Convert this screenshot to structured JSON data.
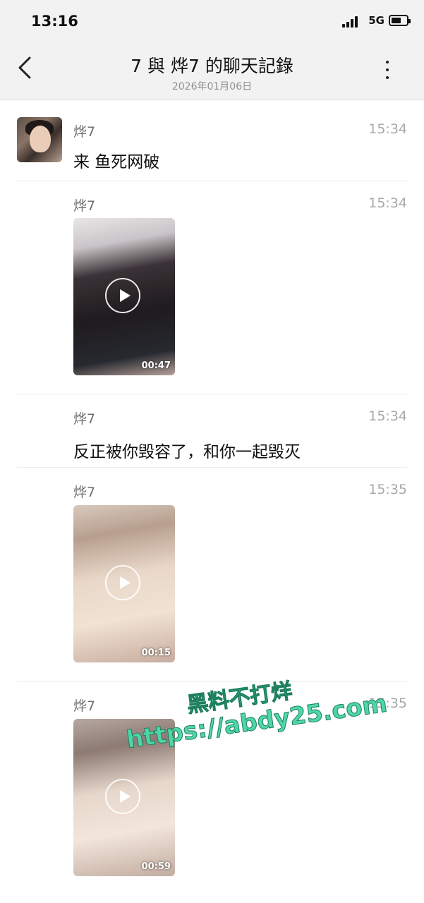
{
  "status": {
    "time": "13:16",
    "network": "5G",
    "icons": [
      "signal-icon",
      "battery-icon"
    ]
  },
  "header": {
    "title": "7 與 烨7 的聊天記錄",
    "date": "2026年01月06日",
    "back_icon": "chevron-left-icon",
    "more_icon": "more-vertical-icon"
  },
  "messages": [
    {
      "type": "text",
      "sender": "烨7",
      "time": "15:34",
      "content": "来 鱼死网破"
    },
    {
      "type": "video",
      "sender": "烨7",
      "time": "15:34",
      "duration": "00:47"
    },
    {
      "type": "text",
      "sender": "烨7",
      "time": "15:34",
      "content": "反正被你毁容了，和你一起毁灭"
    },
    {
      "type": "video",
      "sender": "烨7",
      "time": "15:35",
      "duration": "00:15"
    },
    {
      "type": "video",
      "sender": "烨7",
      "time": "15:35",
      "duration": "00:59"
    }
  ],
  "watermark": {
    "line1": "黑料不打烊",
    "line2": "https://abdy25.com"
  },
  "colors": {
    "header_bg": "#f2f2f2",
    "watermark": "#4fd6a8",
    "timestamp": "#a8a8a8"
  }
}
